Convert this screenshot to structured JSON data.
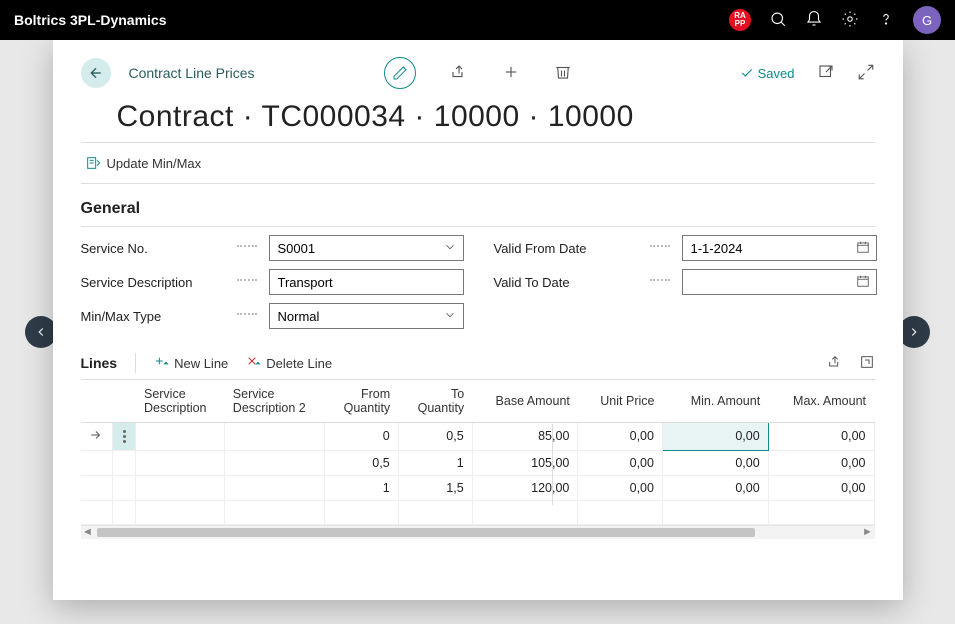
{
  "header": {
    "brand": "Boltrics 3PL-Dynamics",
    "badge_top": "RA",
    "badge_bottom": "PP",
    "avatar": "G"
  },
  "panel": {
    "breadcrumb": "Contract Line Prices",
    "status": "Saved",
    "title": "Contract · TC000034 · 10000 · 10000",
    "update_action": "Update Min/Max"
  },
  "sections": {
    "general_title": "General",
    "lines_title": "Lines",
    "new_line": "New Line",
    "delete_line": "Delete Line"
  },
  "fields": {
    "service_no_label": "Service No.",
    "service_no_value": "S0001",
    "service_desc_label": "Service Description",
    "service_desc_value": "Transport",
    "minmax_label": "Min/Max Type",
    "minmax_value": "Normal",
    "valid_from_label": "Valid From Date",
    "valid_from_value": "1-1-2024",
    "valid_to_label": "Valid To Date",
    "valid_to_value": ""
  },
  "columns": {
    "c1": "Service Description",
    "c2": "Service Description 2",
    "c3": "From Quantity",
    "c4": "To Quantity",
    "c5": "Base Amount",
    "c6": "Unit Price",
    "c7": "Min. Amount",
    "c8": "Max. Amount"
  },
  "rows": [
    {
      "from": "0",
      "to": "0,5",
      "base": "85,00",
      "unit": "0,00",
      "min": "0,00",
      "max": "0,00"
    },
    {
      "from": "0,5",
      "to": "1",
      "base": "105,00",
      "unit": "0,00",
      "min": "0,00",
      "max": "0,00"
    },
    {
      "from": "1",
      "to": "1,5",
      "base": "120,00",
      "unit": "0,00",
      "min": "0,00",
      "max": "0,00"
    }
  ]
}
